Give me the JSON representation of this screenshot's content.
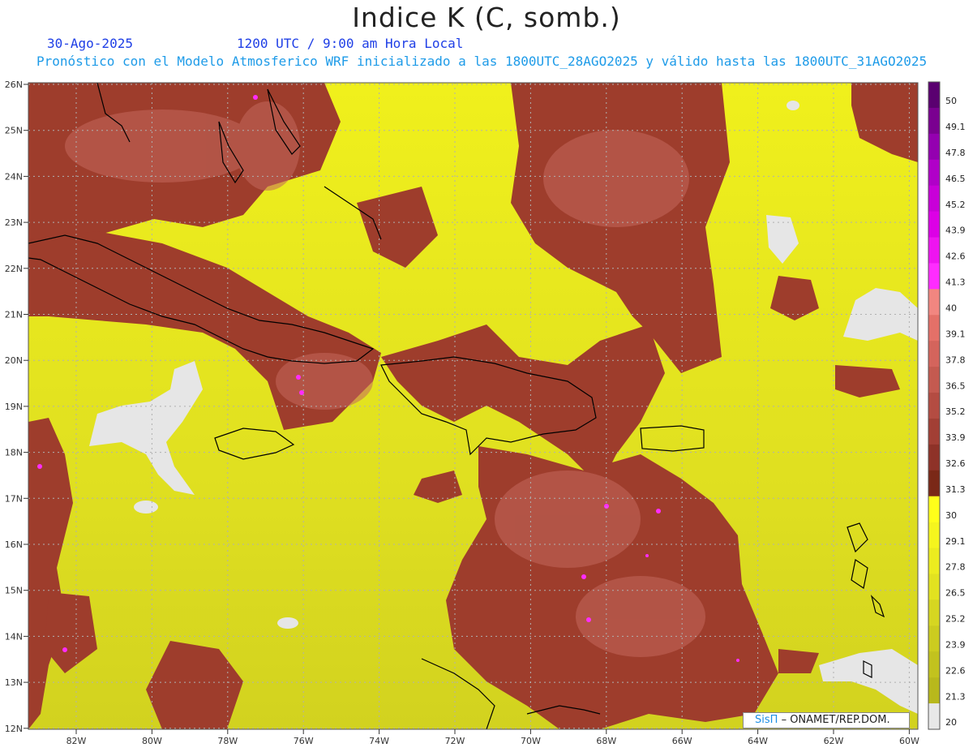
{
  "title": "Indice K (C, somb.)",
  "header": {
    "date": "30-Ago-2025",
    "valid_time": "1200 UTC / 9:00 am Hora Local",
    "model_info": "Pronóstico con el Modelo Atmosferico WRF inicializado a las 1800UTC_28AGO2025 y válido hasta las  1800UTC_31AGO2025"
  },
  "credit": {
    "logo": "SisΠ",
    "text": "– ONAMET/REP.DOM."
  },
  "axes": {
    "lat_labels": [
      "26N",
      "25N",
      "24N",
      "23N",
      "22N",
      "21N",
      "20N",
      "19N",
      "18N",
      "17N",
      "16N",
      "15N",
      "14N",
      "13N",
      "12N"
    ],
    "lon_labels": [
      "82W",
      "80W",
      "78W",
      "76W",
      "74W",
      "72W",
      "70W",
      "68W",
      "66W",
      "64W",
      "62W",
      "60W"
    ]
  },
  "colorbar": {
    "labels": [
      "50",
      "49.1",
      "47.8",
      "46.5",
      "45.2",
      "43.9",
      "42.6",
      "41.3",
      "40",
      "39.1",
      "37.8",
      "36.5",
      "35.2",
      "33.9",
      "32.6",
      "31.3",
      "30",
      "29.1",
      "27.8",
      "26.5",
      "25.2",
      "23.9",
      "22.6",
      "21.3",
      "20"
    ],
    "colors": [
      "#5a0070",
      "#7a0090",
      "#9400b0",
      "#b000c8",
      "#c800d8",
      "#dc00e6",
      "#ee14f0",
      "#ff2cff",
      "#f28680",
      "#e47068",
      "#d4645c",
      "#c45a50",
      "#b44c42",
      "#a23f35",
      "#8e3228",
      "#7a2817",
      "#ffff1a",
      "#f5f51e",
      "#ecec1f",
      "#e2e220",
      "#d6d621",
      "#cccc1f",
      "#c2c21e",
      "#b8b81c",
      "#e8e8e8"
    ]
  },
  "palette": {
    "ocean_yellow": "#e8ec1a",
    "hot_red": "#a0463a",
    "coast": "#000000",
    "grid": "#b0b0b0"
  }
}
